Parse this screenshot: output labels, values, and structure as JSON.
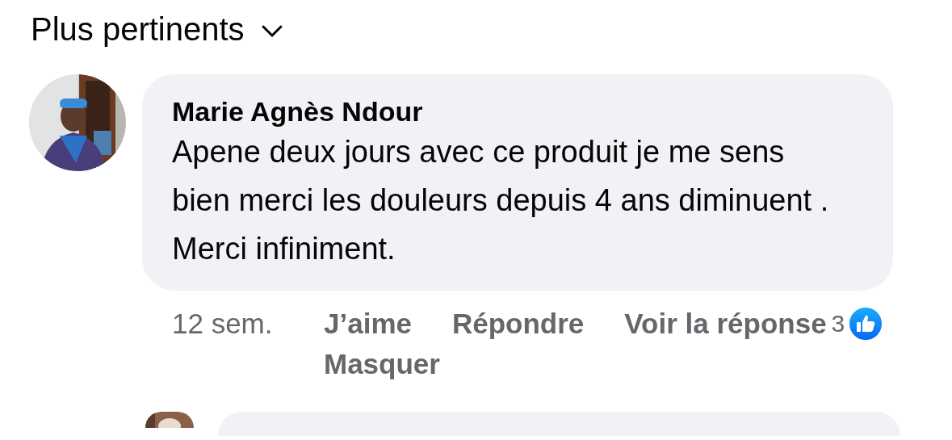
{
  "sort_menu": {
    "label": "Plus pertinents"
  },
  "comments": [
    {
      "author": "Marie Agnès Ndour",
      "text": "Apene deux jours avec ce produit je me sens bien merci les douleurs depuis 4 ans diminuent . Merci infiniment.",
      "time": "12 sem.",
      "actions": [
        "J’aime",
        "Répondre",
        "Voir la réponse",
        "Masquer"
      ],
      "reaction_count": "3"
    }
  ]
}
